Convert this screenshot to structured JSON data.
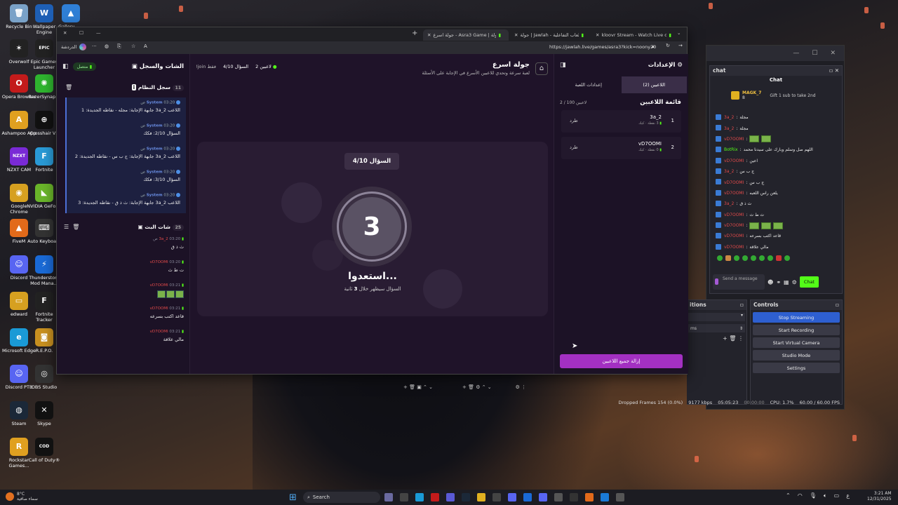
{
  "desktop": {
    "icons": [
      {
        "label": "Recycle Bin",
        "color": "#7aa2c8",
        "glyph": "🗑"
      },
      {
        "label": "Wallpaper Engine",
        "color": "#1e5fb5",
        "glyph": "W"
      },
      {
        "label": "Gallery - ...",
        "color": "#2f7fd6",
        "glyph": "▲"
      },
      {
        "label": "Overwolf",
        "color": "#222",
        "glyph": "✶"
      },
      {
        "label": "Epic Games Launcher",
        "color": "#222",
        "glyph": "EPIC"
      },
      {
        "label": "Opera Browser",
        "color": "#c31b1b",
        "glyph": "O"
      },
      {
        "label": "RazerSynap...",
        "color": "#2fb52f",
        "glyph": "✺"
      },
      {
        "label": "Ashampoo App",
        "color": "#e0a020",
        "glyph": "A"
      },
      {
        "label": "Crosshair V2",
        "color": "#111",
        "glyph": "⊕"
      },
      {
        "label": "NZXT CAM",
        "color": "#7a2ad6",
        "glyph": "NZXT"
      },
      {
        "label": "Fortnite",
        "color": "#2a9ad6",
        "glyph": "F"
      },
      {
        "label": "Google Chrome",
        "color": "#d6a020",
        "glyph": "◉"
      },
      {
        "label": "NVIDIA GeFor...",
        "color": "#6ab52a",
        "glyph": "◣"
      },
      {
        "label": "FiveM",
        "color": "#e26a1a",
        "glyph": "▲"
      },
      {
        "label": "Auto Keyboard",
        "color": "#333",
        "glyph": "⌨"
      },
      {
        "label": "Discord",
        "color": "#5865f2",
        "glyph": "☺"
      },
      {
        "label": "Thunderstore Mod Mana...",
        "color": "#1a6ad6",
        "glyph": "⚡"
      },
      {
        "label": "edward",
        "color": "#d6a020",
        "glyph": "▭"
      },
      {
        "label": "Fortnite Tracker",
        "color": "#222",
        "glyph": "F"
      },
      {
        "label": "Microsoft Edge",
        "color": "#1a9ad6",
        "glyph": "e"
      },
      {
        "label": "R.E.P.O.",
        "color": "#c89020",
        "glyph": "◙"
      },
      {
        "label": "Discord PTB",
        "color": "#5865f2",
        "glyph": "☺"
      },
      {
        "label": "OBS Studio",
        "color": "#333",
        "glyph": "◎"
      },
      {
        "label": "Steam",
        "color": "#1b2838",
        "glyph": "◍"
      },
      {
        "label": "Skype",
        "color": "#111",
        "glyph": "✕"
      },
      {
        "label": "Rockstar Games...",
        "color": "#e0a020",
        "glyph": "R"
      },
      {
        "label": "Call of Duty®",
        "color": "#111",
        "glyph": "COD"
      }
    ]
  },
  "browser": {
    "tabs": [
      {
        "label": "kloovr Stream - Watch Live on Kick",
        "active": false
      },
      {
        "label": "جولة | Jawlah - منصة الألعاب التفاعلية",
        "active": false
      },
      {
        "label": "جولة اسرع - Asra3 Game | جولة",
        "active": true
      }
    ],
    "address_url": "https://jawlah.live/games/asra3?kick=noony20",
    "left_label": "الدردشة"
  },
  "game": {
    "title": "جولة اسرع",
    "subtitle": "لعبة سرعة وتحدي للاعبين الأسرع في الإجابة على الأسئلة",
    "players_count_label": "2 لاعبين",
    "question_progress": "السؤال 4/10",
    "join_label": "!join فقط",
    "question_badge": "السؤال 4/10",
    "countdown": "3",
    "ready_text": "استعدوا...",
    "appear_text": "السؤال سيظهر خلال",
    "appear_seconds": "3",
    "appear_unit": "ثانية"
  },
  "left_panel": {
    "title": "الشات والسجل",
    "status": "متصل",
    "system_log_title": "سجل النظام",
    "system_log_count": "11",
    "logs": [
      {
        "time": "03:20 ص",
        "sender": "System",
        "text": "اللاعب 3a_2 جابهة الإجابة: مجله - نقاطه الجديدة: 1"
      },
      {
        "time": "03:20 ص",
        "sender": "System",
        "text": "السؤال 2/10: فكك"
      },
      {
        "time": "03:20 ص",
        "sender": "System",
        "text": "اللاعب 3a_2 جابهة الإجابة: ج ب س - نقاطه الجديدة: 2"
      },
      {
        "time": "03:20 ص",
        "sender": "System",
        "text": "السؤال 3/10: فكك"
      },
      {
        "time": "03:20 ص",
        "sender": "System",
        "text": "اللاعب 3a_2 جابهة الإجابة: ث ذ ق - نقاطه الجديدة: 3"
      }
    ],
    "chat_title": "شات البث",
    "chat_count": "25",
    "chat": [
      {
        "time": "03:20 ص",
        "user": "3a_2",
        "text": "ث ذ ق",
        "emotes": 0
      },
      {
        "time": "03:20",
        "user": "vD7OOMI",
        "text": "ت ط ث",
        "emotes": 0
      },
      {
        "time": "03:21",
        "user": "vD7OOMI",
        "text": "",
        "emotes": 3
      },
      {
        "time": "03:21",
        "user": "vD7OOMI",
        "text": "قاعد اكتب بسرعه",
        "emotes": 0
      },
      {
        "time": "03:21",
        "user": "vD7OOMI",
        "text": "مالي علاقة",
        "emotes": 0
      }
    ]
  },
  "right_panel": {
    "title": "الإعدادات",
    "tab_players": "اللاعبين (2)",
    "tab_game": "إعدادات اللعبة",
    "list_title": "قائمة اللاعبين",
    "list_count": "2 / 100 لاعبين",
    "kick_label": "طرد",
    "players": [
      {
        "rank": "1",
        "name": "3a_2",
        "sub": "3 نقطة · كيك"
      },
      {
        "rank": "2",
        "name": "vD7OOMI",
        "sub": "0 نقطة · كيك"
      }
    ],
    "remove_all": "إزالة جميع اللاعبين"
  },
  "obs": {
    "chat_dock_title": "chat",
    "chat_header": "Chat",
    "sub_user": "MAGK_7",
    "sub_count": "8",
    "gift_text": "Gift 1 sub to take 2nd",
    "chat_lines": [
      {
        "user": "3a_2",
        "text": "مجلة"
      },
      {
        "user": "3a_2",
        "text": "مجلة"
      },
      {
        "user": "vD7OOMI",
        "text": "",
        "emotes": 2
      },
      {
        "user": "BotRix",
        "text": "اللهم صل وسلم وبارك على سيدنا محمد"
      },
      {
        "user": "vD7OOMI",
        "text": "اعين"
      },
      {
        "user": "3a_2",
        "text": "ج ب س"
      },
      {
        "user": "vD7OOMI",
        "text": "ج ب س"
      },
      {
        "user": "vD7OOMI",
        "text": "يلعن راس اللعبه"
      },
      {
        "user": "3a_2",
        "text": "ث ذ ق"
      },
      {
        "user": "vD7OOMI",
        "text": "ث ط ث"
      },
      {
        "user": "vD7OOMI",
        "text": "",
        "emotes": 3
      },
      {
        "user": "vD7OOMI",
        "text": "قاعد اكتب بسرعه"
      },
      {
        "user": "vD7OOMI",
        "text": "مالي علاقة"
      }
    ],
    "send_placeholder": "Send a message",
    "send_button": "Chat",
    "controls_title": "Controls",
    "transitions_title": "itions",
    "ms_label": "ms",
    "controls": [
      "Stop Streaming",
      "Start Recording",
      "Start Virtual Camera",
      "Studio Mode",
      "Settings"
    ],
    "status_dropped": "Dropped Frames 154 (0.0%)",
    "status_kbps": "9177 kbps",
    "status_time1": "05:05:23",
    "status_time2": "00:00:00",
    "status_cpu": "CPU: 1.7%",
    "status_fps": "60.00 / 60.00 FPS"
  },
  "taskbar": {
    "weather_temp": "8°C",
    "weather_desc": "سماء صافية",
    "search_placeholder": "Search",
    "lang": "ع",
    "time": "3:21 AM",
    "date": "12/31/2025"
  }
}
